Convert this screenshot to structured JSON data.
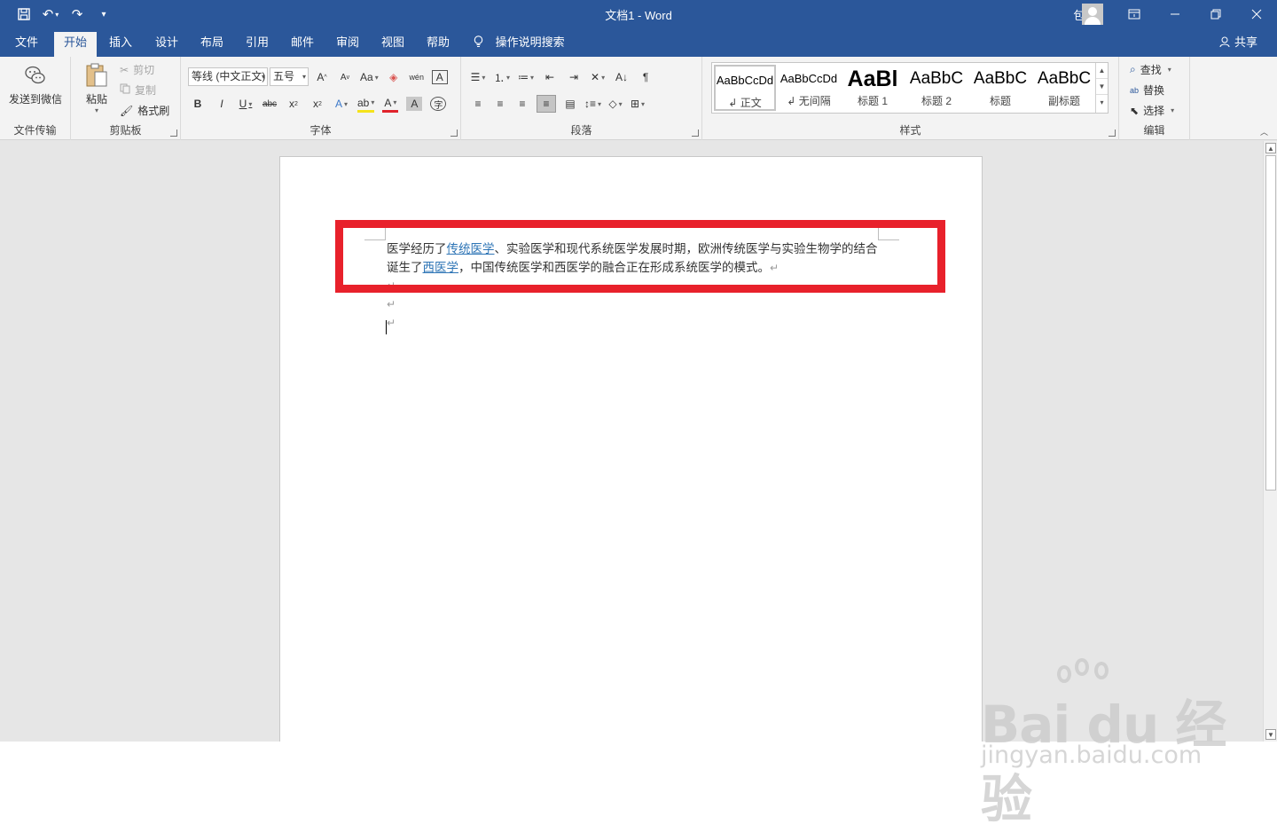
{
  "window": {
    "title": "文档1  -  Word",
    "user_name": "包 珍"
  },
  "tabs": [
    {
      "label": "文件"
    },
    {
      "label": "开始"
    },
    {
      "label": "插入"
    },
    {
      "label": "设计"
    },
    {
      "label": "布局"
    },
    {
      "label": "引用"
    },
    {
      "label": "邮件"
    },
    {
      "label": "审阅"
    },
    {
      "label": "视图"
    },
    {
      "label": "帮助"
    }
  ],
  "tell_me": "操作说明搜索",
  "share": "共享",
  "ribbon": {
    "file_transfer": {
      "send_wechat": "发送到微信",
      "label": "文件传输"
    },
    "clipboard": {
      "paste": "粘贴",
      "cut": "剪切",
      "copy": "复制",
      "format_painter": "格式刷",
      "label": "剪贴板"
    },
    "font": {
      "font_name": "等线 (中文正文)",
      "font_size": "五号",
      "label": "字体"
    },
    "paragraph": {
      "label": "段落"
    },
    "styles": {
      "items": [
        {
          "preview": "AaBbCcDd",
          "name": "正文"
        },
        {
          "preview": "AaBbCcDd",
          "name": "无间隔"
        },
        {
          "preview": "AaBl",
          "name": "标题 1"
        },
        {
          "preview": "AaBbC",
          "name": "标题 2"
        },
        {
          "preview": "AaBbC",
          "name": "标题"
        },
        {
          "preview": "AaBbC",
          "name": "副标题"
        }
      ],
      "label": "样式"
    },
    "editing": {
      "find": "查找",
      "replace": "替换",
      "select": "选择",
      "label": "编辑"
    }
  },
  "document": {
    "para1": {
      "t1": "医学经历了",
      "link1": "传统医学",
      "t2": "、实验医学和现代系统医学发展时期，欧洲传统医学与实验生物学的结合诞生了",
      "link2": "西医学",
      "t3": "，中国传统医学和西医学的融合正在形成系统医学的模式。"
    },
    "paragraph_mark": "↵"
  },
  "watermark": {
    "logo": "Bai du 经验",
    "url": "jingyan.baidu.com"
  },
  "colors": {
    "ribbon_blue": "#2b579a",
    "highlight_red": "#e8212b",
    "link_blue": "#2e75b6"
  }
}
